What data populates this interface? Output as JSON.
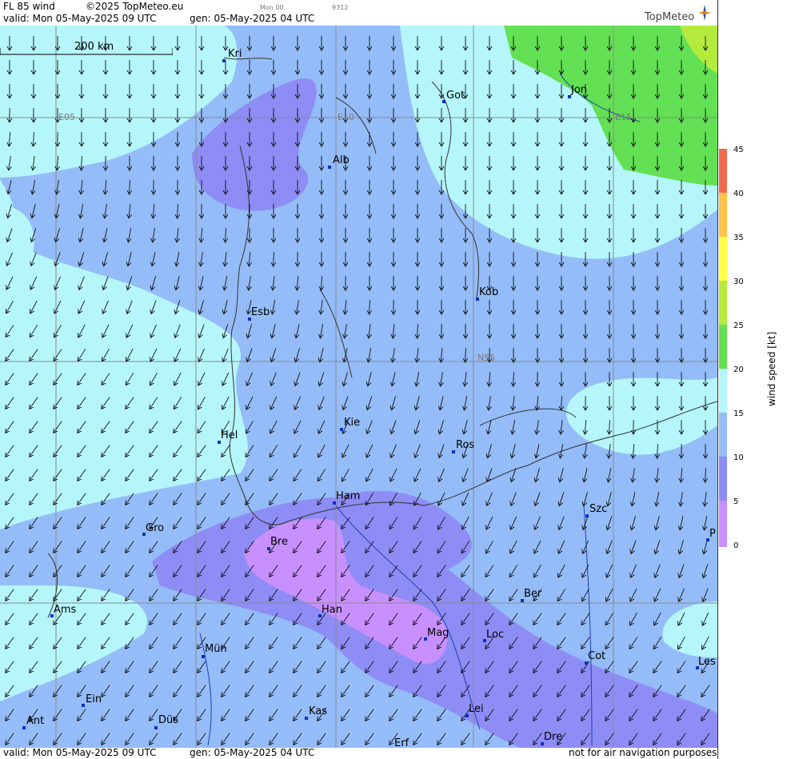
{
  "header": {
    "product": "FL 85 wind",
    "copyright": "©2025 TopMeteo.eu",
    "run_code": "Mon 00",
    "id_code": "9312",
    "valid": "valid:  Mon  05-May-2025  09 UTC",
    "gen": "gen: 05-May-2025 04 UTC",
    "logo": "TopMeteo"
  },
  "footer": {
    "valid": "valid:  Mon  05-May-2025  09 UTC",
    "gen": "gen: 05-May-2025 04 UTC",
    "disclaimer": "not for air navigation purposes"
  },
  "scale_bar": {
    "label": "200 km"
  },
  "grid_labels": {
    "e05": "E05",
    "e10": "E10",
    "e15": "E15",
    "n55": "N55"
  },
  "cities": [
    {
      "name": "Kri"
    },
    {
      "name": "Got"
    },
    {
      "name": "Jon"
    },
    {
      "name": "Alb"
    },
    {
      "name": "Esb"
    },
    {
      "name": "Kob"
    },
    {
      "name": "Kie"
    },
    {
      "name": "Hel"
    },
    {
      "name": "Ros"
    },
    {
      "name": "Ham"
    },
    {
      "name": "Szc"
    },
    {
      "name": "Gro"
    },
    {
      "name": "Bre"
    },
    {
      "name": "P"
    },
    {
      "name": "Ber"
    },
    {
      "name": "Ams"
    },
    {
      "name": "Han"
    },
    {
      "name": "Mag"
    },
    {
      "name": "Loc"
    },
    {
      "name": "Cot"
    },
    {
      "name": "Les"
    },
    {
      "name": "Mün"
    },
    {
      "name": "Ein"
    },
    {
      "name": "Kas"
    },
    {
      "name": "Lei"
    },
    {
      "name": "Ant"
    },
    {
      "name": "Düs"
    },
    {
      "name": "Dre"
    },
    {
      "name": "Erf"
    }
  ],
  "colorbar": {
    "title": "wind speed [kt]",
    "ticks": [
      "45",
      "40",
      "35",
      "30",
      "25",
      "20",
      "15",
      "10",
      "5",
      "0"
    ],
    "colors": {
      "0_5": "#c890ff",
      "5_10": "#8e8cf5",
      "10_15": "#94bcf8",
      "15_20": "#b5f6fa",
      "20_25": "#63e054",
      "25_30": "#b4ea3c",
      "30_35": "#ffff46",
      "35_40": "#ffc24a",
      "40_45": "#f06a4e"
    }
  }
}
